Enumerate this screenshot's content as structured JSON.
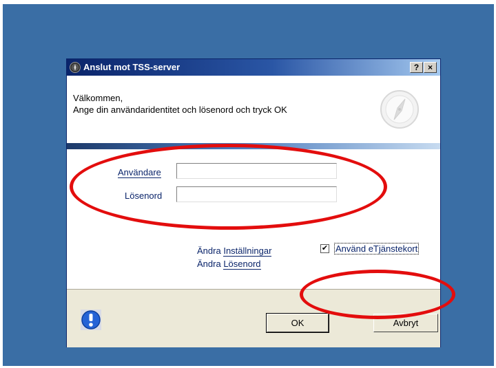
{
  "dialog": {
    "title": "Anslut mot TSS-server",
    "help_label": "?",
    "close_label": "×"
  },
  "header": {
    "line1": "Välkommen,",
    "line2": "Ange din användaridentitet och lösenord och tryck OK"
  },
  "form": {
    "username_label": "Användare",
    "username_value": "",
    "password_label": "Lösenord",
    "password_value": ""
  },
  "links": {
    "change1_prefix": "Ändra",
    "change1_link": "Inställningar",
    "change2_prefix": "Ändra",
    "change2_link": "Lösenord"
  },
  "checkbox": {
    "label": "Använd eTjänstekort",
    "checked": true,
    "mark": "✔"
  },
  "buttons": {
    "ok": "OK",
    "cancel": "Avbryt"
  },
  "annotation_color": "#e30d0d"
}
